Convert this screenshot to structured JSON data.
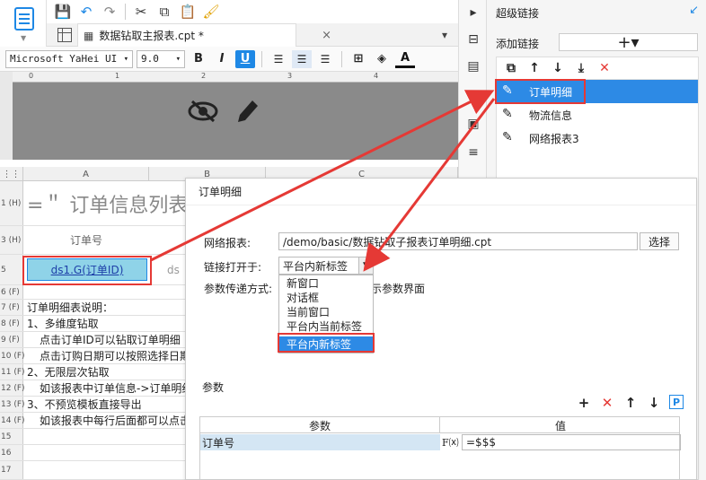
{
  "window": {
    "tab_title": "数据钻取主报表.cpt *",
    "tab_close": "×"
  },
  "toolbar2": {
    "font_family": "Microsoft YaHei UI",
    "font_size": "9.0",
    "bold_label": "B",
    "italic_label": "I",
    "underline_label": "U",
    "font_color_label": "A"
  },
  "ruler": {
    "ticks": [
      "0",
      "1",
      "2",
      "3",
      "4"
    ]
  },
  "sheet": {
    "columns": [
      "A",
      "B",
      "C"
    ],
    "rows": [
      {
        "num": "1 (H)",
        "a": "=＂ 订单信息列表"
      },
      {
        "num": "3 (H)",
        "a": "订单号"
      },
      {
        "num": "5",
        "a": "ds1.G(订单ID)",
        "b": "ds"
      },
      {
        "num": "6 (F)",
        "a": ""
      },
      {
        "num": "7 (F)",
        "a": "订单明细表说明："
      },
      {
        "num": "8 (F)",
        "a": "1、多维度钻取"
      },
      {
        "num": "9 (F)",
        "a": "点击订单ID可以钻取订单明细"
      },
      {
        "num": "10 (F)",
        "a": "点击订购日期可以按照选择日期"
      },
      {
        "num": "11 (F)",
        "a": "2、无限层次钻取"
      },
      {
        "num": "12 (F)",
        "a": "如该报表中订单信息->订单明细"
      },
      {
        "num": "13 (F)",
        "a": "3、不预览模板直接导出"
      },
      {
        "num": "14 (F)",
        "a": "如该报表中每行后面都可以点击"
      },
      {
        "num": "15",
        "a": ""
      },
      {
        "num": "16",
        "a": ""
      },
      {
        "num": "17",
        "a": ""
      }
    ]
  },
  "hyperlink_panel": {
    "title": "超级链接",
    "add_label": "添加链接",
    "add_button": "+▾",
    "items": [
      {
        "label": "订单明细",
        "selected": true
      },
      {
        "label": "物流信息",
        "selected": false
      },
      {
        "label": "网络报表3",
        "selected": false
      }
    ]
  },
  "dialog": {
    "title": "订单明细",
    "report_label": "网络报表:",
    "report_path": "/demo/basic/数据钻取子报表订单明细.cpt",
    "choose_button": "选择",
    "open_label": "链接打开于:",
    "open_value": "平台内新标签",
    "open_options": [
      "新窗口",
      "对话框",
      "当前窗口",
      "平台内当前标签",
      "平台内新标签"
    ],
    "param_method_label": "参数传递方式:",
    "show_param_text": "展示参数界面",
    "params_label": "参数",
    "params_table": {
      "headers": [
        "参数",
        "值"
      ],
      "rows": [
        {
          "name": "订单号",
          "value": "=$$$"
        }
      ]
    }
  },
  "colors": {
    "accent": "#1e88e5",
    "selection": "#2d8ae5",
    "annotation_red": "#e53935",
    "canvas_gray": "#8a8a8a"
  }
}
